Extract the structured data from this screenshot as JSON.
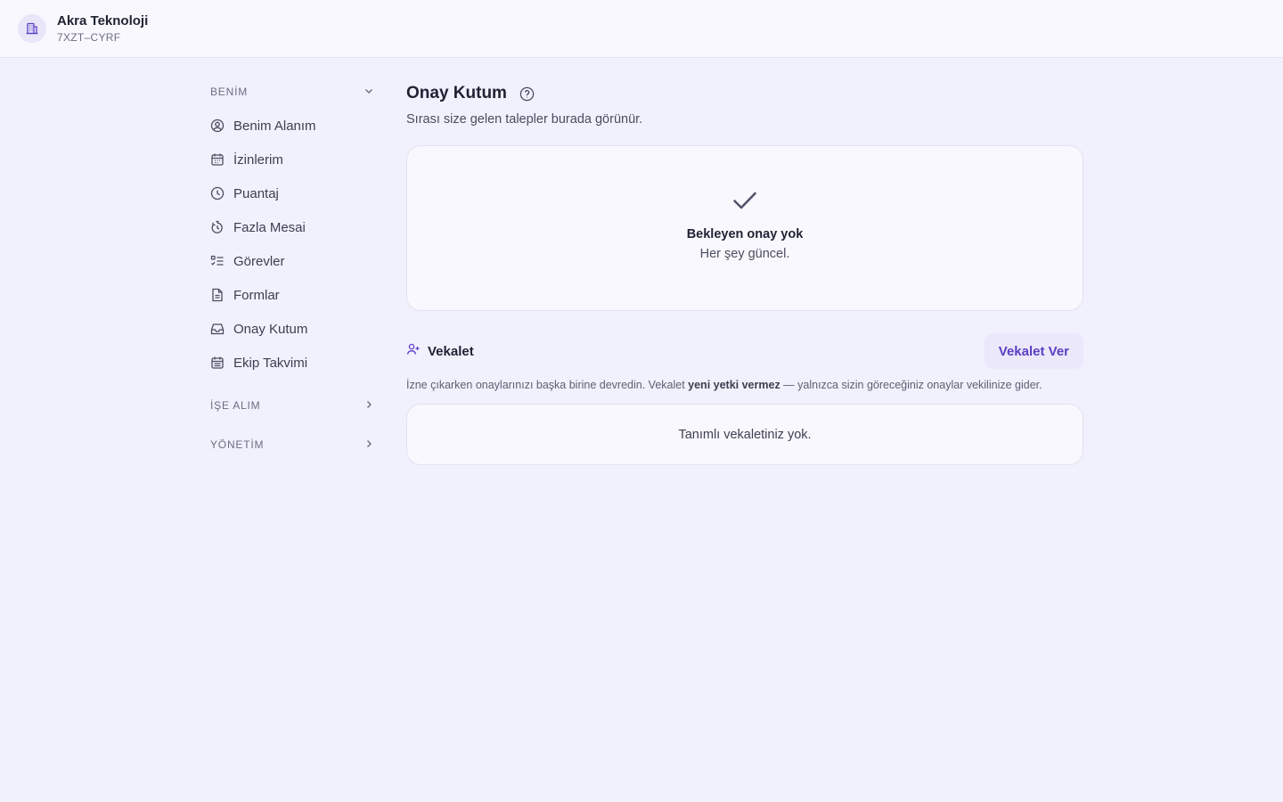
{
  "org": {
    "name": "Akra Teknoloji",
    "code": "7XZT–CYRF",
    "icon": "building-icon"
  },
  "sidebar": {
    "sections": [
      {
        "label": "BENİM",
        "expanded": true,
        "items": [
          {
            "label": "Benim Alanım",
            "icon": "user-circle-icon"
          },
          {
            "label": "İzinlerim",
            "icon": "calendar-icon"
          },
          {
            "label": "Puantaj",
            "icon": "clock-icon"
          },
          {
            "label": "Fazla Mesai",
            "icon": "timer-icon"
          },
          {
            "label": "Görevler",
            "icon": "checklist-icon"
          },
          {
            "label": "Formlar",
            "icon": "document-icon"
          },
          {
            "label": "Onay Kutum",
            "icon": "inbox-icon"
          },
          {
            "label": "Ekip Takvimi",
            "icon": "calendar-grid-icon"
          }
        ]
      },
      {
        "label": "İŞE ALIM",
        "expanded": false
      },
      {
        "label": "YÖNETİM",
        "expanded": false
      }
    ]
  },
  "main": {
    "title": "Onay Kutum",
    "subtitle": "Sırası size gelen talepler burada görünür.",
    "empty_state": {
      "title": "Bekleyen onay yok",
      "subtitle": "Her şey güncel."
    },
    "proxy": {
      "title": "Vekalet",
      "button_label": "Vekalet Ver",
      "desc_before": "İzne çıkarken onaylarınızı başka birine devredin. Vekalet ",
      "desc_bold": "yeni yetki vermez",
      "desc_after": " — yalnızca sizin göreceğiniz onaylar vekilinize gider.",
      "empty_text": "Tanımlı vekaletiniz yok."
    }
  },
  "colors": {
    "accent": "#5b3fc4",
    "background": "#f1f0fd",
    "card": "#f9f8fe"
  }
}
